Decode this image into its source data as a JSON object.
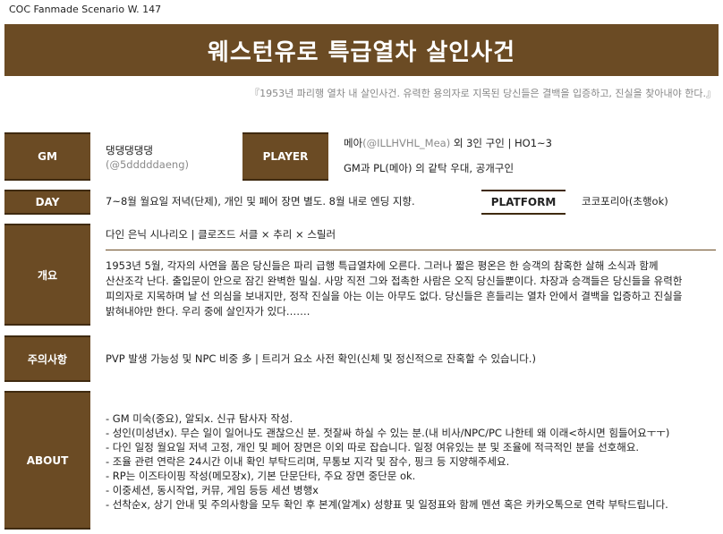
{
  "header": {
    "series": "COC Fanmade Scenario W. 147",
    "title": "웨스턴유로 특급열차 살인사건",
    "tagline": "『1953년 파리행 열차 내 살인사건. 유력한 용의자로 지목된 당신들은 결백을 입증하고, 진실을 찾아내야 한다.』"
  },
  "labels": {
    "gm": "GM",
    "player": "PLAYER",
    "day": "DAY",
    "platform": "PLATFORM",
    "overview": "개요",
    "notice": "주의사항",
    "about": "ABOUT"
  },
  "gm": {
    "name": "댕댕댕댕댕",
    "handle": "(@5dddddaeng)"
  },
  "player": {
    "name": "메아",
    "handle": "(@ILLHVHL_Mea)",
    "recruit": " 외 3인 구인 | HO1~3",
    "note": "GM과 PL(메아) 의 같탁 우대, 공개구인"
  },
  "day": {
    "text": "7~8월 월요일 저녁(단제), 개인 및 페어 장면 별도. 8월 내로 엔딩 지향."
  },
  "platform": {
    "value": "코코포리아(초행ok)"
  },
  "overview": {
    "tags": "다인 은닉 시나리오 | 클로즈드 서클 × 추리 × 스릴러",
    "lines": [
      "1953년 5월, 각자의 사연을 품은 당신들은 파리 급행 특급열차에 오른다. 그러나 짧은 평온은 한 승객의 참혹한 살해 소식과 함께",
      "산산조각 난다. 출입문이 안으로 잠긴 완벽한 밀실. 사망 직전 그와 접촉한 사람은 오직 당신들뿐이다. 차장과 승객들은 당신들을 유력한",
      "피의자로 지목하며 날 선 의심을 보내지만, 정작 진실을 아는 이는 아무도 없다. 당신들은 흔들리는 열차 안에서 결백을 입증하고 진실을",
      "밝혀내야만 한다. 우리 중에 살인자가 있다……."
    ]
  },
  "notice": {
    "text": "PVP 발생 가능성 및 NPC 비중 多 | 트리거 요소 사전 확인(신체 및 정신적으로 잔혹할 수 있습니다.)"
  },
  "about": {
    "items": [
      "- GM 미숙(중요), 알되x. 신규 탐사자 작성.",
      "- 성인(미성년x). 무슨 일이 일어나도 괜찮으신 분. 젓잘싸 하실 수 있는 분.(내 비사/NPC/PC 나한테 왜 이래<하시면 힘들어요ㅜㅜ)",
      "- 다인 일정 월요일 저녁 고정, 개인 및 페어 장면은 이외 따로 잡습니다. 일정 여유있는 분 및 조율에 적극적인 분을 선호해요.",
      "- 조율 관련 연락은 24시간 이내 확인 부탁드리며, 무통보 지각 및 잠수, 핑크 등 지양해주세요.",
      "- RP는 이즈타이핑 작성(메모장x), 기본 단문단타, 주요 장면 중단문 ok.",
      "- 이중세션, 동시작업, 커뮤, 게임 등등 세션 병행x",
      "- 선착순x, 상기 안내 및 주의사항을 모두 확인 후 본계(알계x) 성향표 및 일정표와 함께 멘션 혹은 카카오톡으로 연락 부탁드립니다."
    ]
  },
  "colors": {
    "brand": "#6b4b24",
    "muted": "#8a8a8a"
  }
}
